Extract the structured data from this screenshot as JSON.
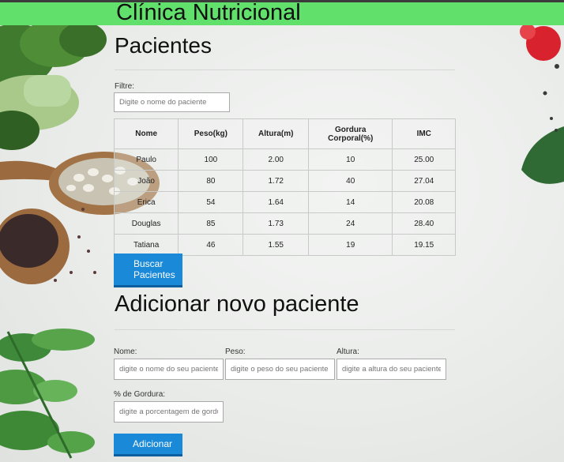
{
  "header": {
    "title": "Clínica Nutricional"
  },
  "patients": {
    "heading": "Pacientes",
    "filter_label": "Filtre:",
    "filter_placeholder": "Digite o nome do paciente",
    "columns": [
      "Nome",
      "Peso(kg)",
      "Altura(m)",
      "Gordura Corporal(%)",
      "IMC"
    ],
    "rows": [
      [
        "Paulo",
        "100",
        "2.00",
        "10",
        "25.00"
      ],
      [
        "João",
        "80",
        "1.72",
        "40",
        "27.04"
      ],
      [
        "Erica",
        "54",
        "1.64",
        "14",
        "20.08"
      ],
      [
        "Douglas",
        "85",
        "1.73",
        "24",
        "28.40"
      ],
      [
        "Tatiana",
        "46",
        "1.55",
        "19",
        "19.15"
      ]
    ],
    "search_button": "Buscar Pacientes"
  },
  "form": {
    "heading": "Adicionar novo paciente",
    "name_label": "Nome:",
    "name_placeholder": "digite o nome do seu paciente",
    "weight_label": "Peso:",
    "weight_placeholder": "digite o peso do seu paciente",
    "height_label": "Altura:",
    "height_placeholder": "digite a altura do seu paciente",
    "fat_label": "% de Gordura:",
    "fat_placeholder": "digite a porcentagem de gordura",
    "submit": "Adicionar"
  },
  "colors": {
    "header": "#62e06c",
    "button": "#1a89d8"
  }
}
